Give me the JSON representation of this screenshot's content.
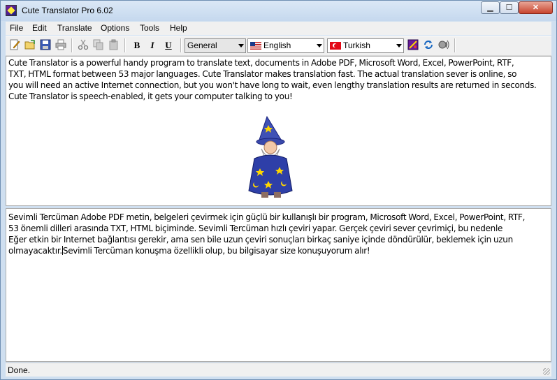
{
  "window": {
    "title": "Cute Translator Pro 6.02"
  },
  "caption_buttons": {
    "minimize": "▁",
    "maximize": "☐",
    "close": "✕"
  },
  "menu": [
    "File",
    "Edit",
    "Translate",
    "Options",
    "Tools",
    "Help"
  ],
  "toolbar": {
    "icons": [
      "new-icon",
      "open-icon",
      "save-icon",
      "print-icon",
      "cut-icon",
      "copy-icon",
      "paste-icon",
      "bold-icon",
      "italic-icon",
      "underline-icon",
      "flag-icon",
      "swap-icon",
      "speak-icon"
    ],
    "bold": "B",
    "italic": "I",
    "underline": "U",
    "subject": "General",
    "source_language": "English",
    "target_language": "Turkish"
  },
  "source_text": [
    "Cute Translator is a powerful handy program to translate text, documents in Adobe PDF, Microsoft Word, Excel, PowerPoint, RTF,",
    "TXT, HTML format between 53 major languages. Cute Translator makes translation fast. The actual translation sever is online, so",
    "you will need an active Internet connection, but you won't have long to wait, even lengthy translation results are returned in seconds.",
    "Cute Translator is speech-enabled, it gets your computer talking to you!"
  ],
  "target_text": [
    "Sevimli Tercüman Adobe PDF metin, belgeleri çevirmek için güçlü bir kullanışlı bir program, Microsoft Word, Excel, PowerPoint, RTF,",
    "53 önemli dilleri arasında TXT, HTML biçiminde. Sevimli Tercüman hızlı çeviri yapar. Gerçek çeviri sever çevrimiçi, bu nedenle",
    "Eğer etkin bir Internet bağlantısı gerekir, ama sen bile uzun çeviri sonuçları birkaç saniye içinde döndürülür, beklemek için uzun",
    "olmayacaktır.",
    "Sevimli Tercüman konuşma özellikli olup, bu bilgisayar size konuşuyorum alır!"
  ],
  "status": "Done.",
  "colors": {
    "title_bar": "#c5d8ee",
    "chrome": "#f0f0f0",
    "close_button": "#c8452f"
  }
}
